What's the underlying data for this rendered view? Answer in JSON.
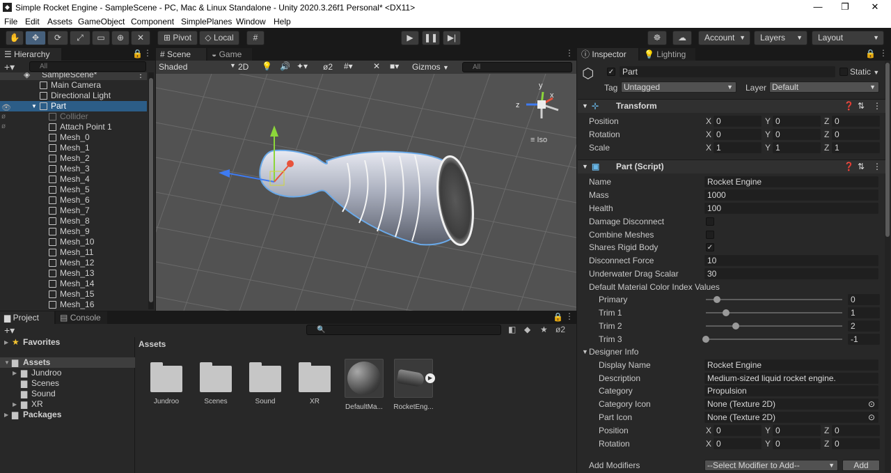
{
  "window": {
    "title": "Simple Rocket Engine - SampleScene - PC, Mac & Linux Standalone - Unity 2020.3.26f1 Personal* <DX11>",
    "app_icon": "unity-logo-icon",
    "minimize": "—",
    "maximize": "❐",
    "close": "✕"
  },
  "menu": [
    "File",
    "Edit",
    "Assets",
    "GameObject",
    "Component",
    "SimplePlanes",
    "Window",
    "Help"
  ],
  "toolbar": {
    "pivot": "Pivot",
    "local": "Local",
    "account": "Account",
    "layers": "Layers",
    "layout": "Layout"
  },
  "hierarchy": {
    "tab": "Hierarchy",
    "search_placeholder": "All",
    "scene": "SampleScene*",
    "items": [
      {
        "label": "Main Camera",
        "indent": 1,
        "state": "normal"
      },
      {
        "label": "Directional Light",
        "indent": 1,
        "state": "normal"
      },
      {
        "label": "Part",
        "indent": 1,
        "state": "selected"
      },
      {
        "label": "Collider",
        "indent": 2,
        "state": "disabled"
      },
      {
        "label": "Attach Point 1",
        "indent": 2,
        "state": "normal"
      },
      {
        "label": "Mesh_0",
        "indent": 2,
        "state": "normal"
      },
      {
        "label": "Mesh_1",
        "indent": 2,
        "state": "normal"
      },
      {
        "label": "Mesh_2",
        "indent": 2,
        "state": "normal"
      },
      {
        "label": "Mesh_3",
        "indent": 2,
        "state": "normal"
      },
      {
        "label": "Mesh_4",
        "indent": 2,
        "state": "normal"
      },
      {
        "label": "Mesh_5",
        "indent": 2,
        "state": "normal"
      },
      {
        "label": "Mesh_6",
        "indent": 2,
        "state": "normal"
      },
      {
        "label": "Mesh_7",
        "indent": 2,
        "state": "normal"
      },
      {
        "label": "Mesh_8",
        "indent": 2,
        "state": "normal"
      },
      {
        "label": "Mesh_9",
        "indent": 2,
        "state": "normal"
      },
      {
        "label": "Mesh_10",
        "indent": 2,
        "state": "normal"
      },
      {
        "label": "Mesh_11",
        "indent": 2,
        "state": "normal"
      },
      {
        "label": "Mesh_12",
        "indent": 2,
        "state": "normal"
      },
      {
        "label": "Mesh_13",
        "indent": 2,
        "state": "normal"
      },
      {
        "label": "Mesh_14",
        "indent": 2,
        "state": "normal"
      },
      {
        "label": "Mesh_15",
        "indent": 2,
        "state": "normal"
      },
      {
        "label": "Mesh_16",
        "indent": 2,
        "state": "normal"
      }
    ]
  },
  "scene": {
    "tab_scene": "Scene",
    "tab_game": "Game",
    "shading": "Shaded",
    "mode_2d": "2D",
    "hidden_count": "2",
    "gizmos": "Gizmos",
    "search_placeholder": "All",
    "gizmo_axes": {
      "x": "x",
      "y": "y",
      "z": "z"
    },
    "projection": "Iso"
  },
  "project": {
    "tab_project": "Project",
    "tab_console": "Console",
    "favorites": "Favorites",
    "assets_root": "Assets",
    "tree": [
      "Jundroo",
      "Scenes",
      "Sound",
      "XR"
    ],
    "packages": "Packages",
    "breadcrumb": "Assets",
    "hidden_count": "2",
    "items": [
      {
        "label": "Jundroo",
        "kind": "folder"
      },
      {
        "label": "Scenes",
        "kind": "folder"
      },
      {
        "label": "Sound",
        "kind": "folder"
      },
      {
        "label": "XR",
        "kind": "folder"
      },
      {
        "label": "DefaultMa...",
        "kind": "material"
      },
      {
        "label": "RocketEng...",
        "kind": "prefab"
      }
    ]
  },
  "inspector": {
    "tab_inspector": "Inspector",
    "tab_lighting": "Lighting",
    "object_name": "Part",
    "static": "Static",
    "tag_label": "Tag",
    "tag": "Untagged",
    "layer_label": "Layer",
    "layer": "Default",
    "transform": {
      "title": "Transform",
      "rows": [
        {
          "label": "Position",
          "x": "0",
          "y": "0",
          "z": "0"
        },
        {
          "label": "Rotation",
          "x": "0",
          "y": "0",
          "z": "0"
        },
        {
          "label": "Scale",
          "x": "1",
          "y": "1",
          "z": "1"
        }
      ]
    },
    "part_script": {
      "title": "Part (Script)",
      "name_label": "Name",
      "name": "Rocket Engine",
      "mass_label": "Mass",
      "mass": "1000",
      "health_label": "Health",
      "health": "100",
      "damage_disconnect_label": "Damage Disconnect",
      "damage_disconnect": false,
      "combine_meshes_label": "Combine Meshes",
      "combine_meshes": false,
      "shares_rigid_body_label": "Shares Rigid Body",
      "shares_rigid_body": true,
      "disconnect_force_label": "Disconnect Force",
      "disconnect_force": "10",
      "drag_scalar_label": "Underwater Drag Scalar",
      "drag_scalar": "30",
      "color_index_label": "Default Material Color Index Values",
      "colors": [
        {
          "label": "Primary",
          "value": "0",
          "fraction": 0.08
        },
        {
          "label": "Trim 1",
          "value": "1",
          "fraction": 0.15
        },
        {
          "label": "Trim 2",
          "value": "2",
          "fraction": 0.22
        },
        {
          "label": "Trim 3",
          "value": "-1",
          "fraction": 0.0
        }
      ],
      "designer_info_label": "Designer Info",
      "display_name_label": "Display Name",
      "display_name": "Rocket Engine",
      "description_label": "Description",
      "description": "Medium-sized liquid rocket engine.",
      "category_label": "Category",
      "category": "Propulsion",
      "category_icon_label": "Category Icon",
      "category_icon": "None (Texture 2D)",
      "part_icon_label": "Part Icon",
      "part_icon": "None (Texture 2D)",
      "position_label": "Position",
      "pos": {
        "x": "0",
        "y": "0",
        "z": "0"
      },
      "rotation_label": "Rotation",
      "rot": {
        "x": "0",
        "y": "0",
        "z": "0"
      },
      "add_modifiers_label": "Add Modifiers",
      "modifier_select": "--Select Modifier to Add--",
      "add_button": "Add"
    }
  },
  "colors": {
    "selection": "#2c5d87",
    "panel": "#282828",
    "accent_blue": "#46607c"
  }
}
